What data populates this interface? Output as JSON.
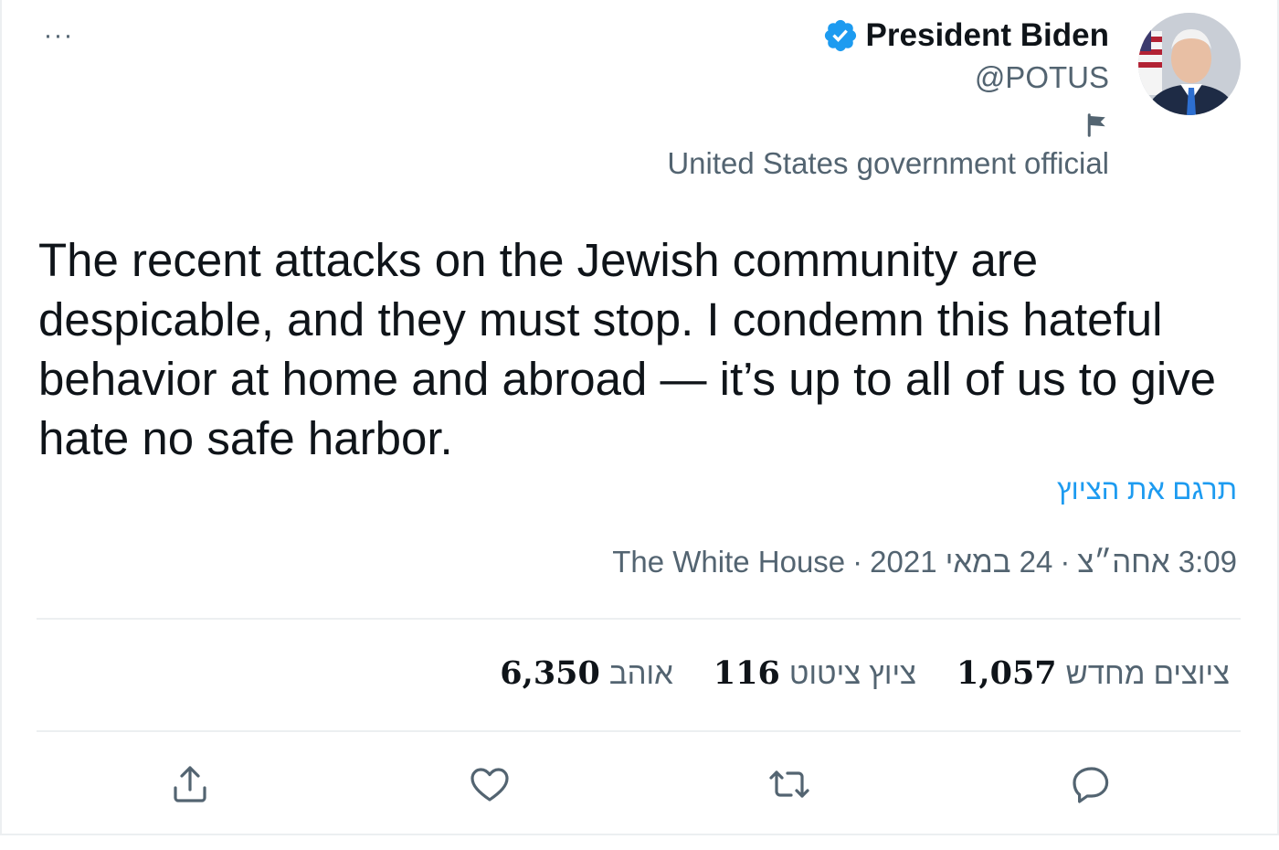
{
  "header": {
    "more_label": "···",
    "display_name": "President Biden",
    "handle": "@POTUS",
    "verified_icon": "verified-badge-icon",
    "gov_label": "United States government official"
  },
  "tweet": {
    "text": "The recent attacks on the Jewish community are despicable, and they must stop. I condemn this hateful behavior at home and abroad — it’s up to all of us to give hate no safe harbor.",
    "translate_label": "תרגם את הציוץ"
  },
  "meta": {
    "time": "3:09 אחה״צ",
    "date": "24 במאי 2021",
    "source": "The White House",
    "separator": "·"
  },
  "stats": {
    "retweets": {
      "value": "1,057",
      "label": "ציוצים מחדש"
    },
    "quotes": {
      "value": "116",
      "label": "ציוץ ציטוט"
    },
    "likes": {
      "value": "6,350",
      "label": "אוהב"
    }
  },
  "colors": {
    "accent": "#1d9bf0",
    "secondary_text": "#536471",
    "divider": "#eceff1"
  }
}
